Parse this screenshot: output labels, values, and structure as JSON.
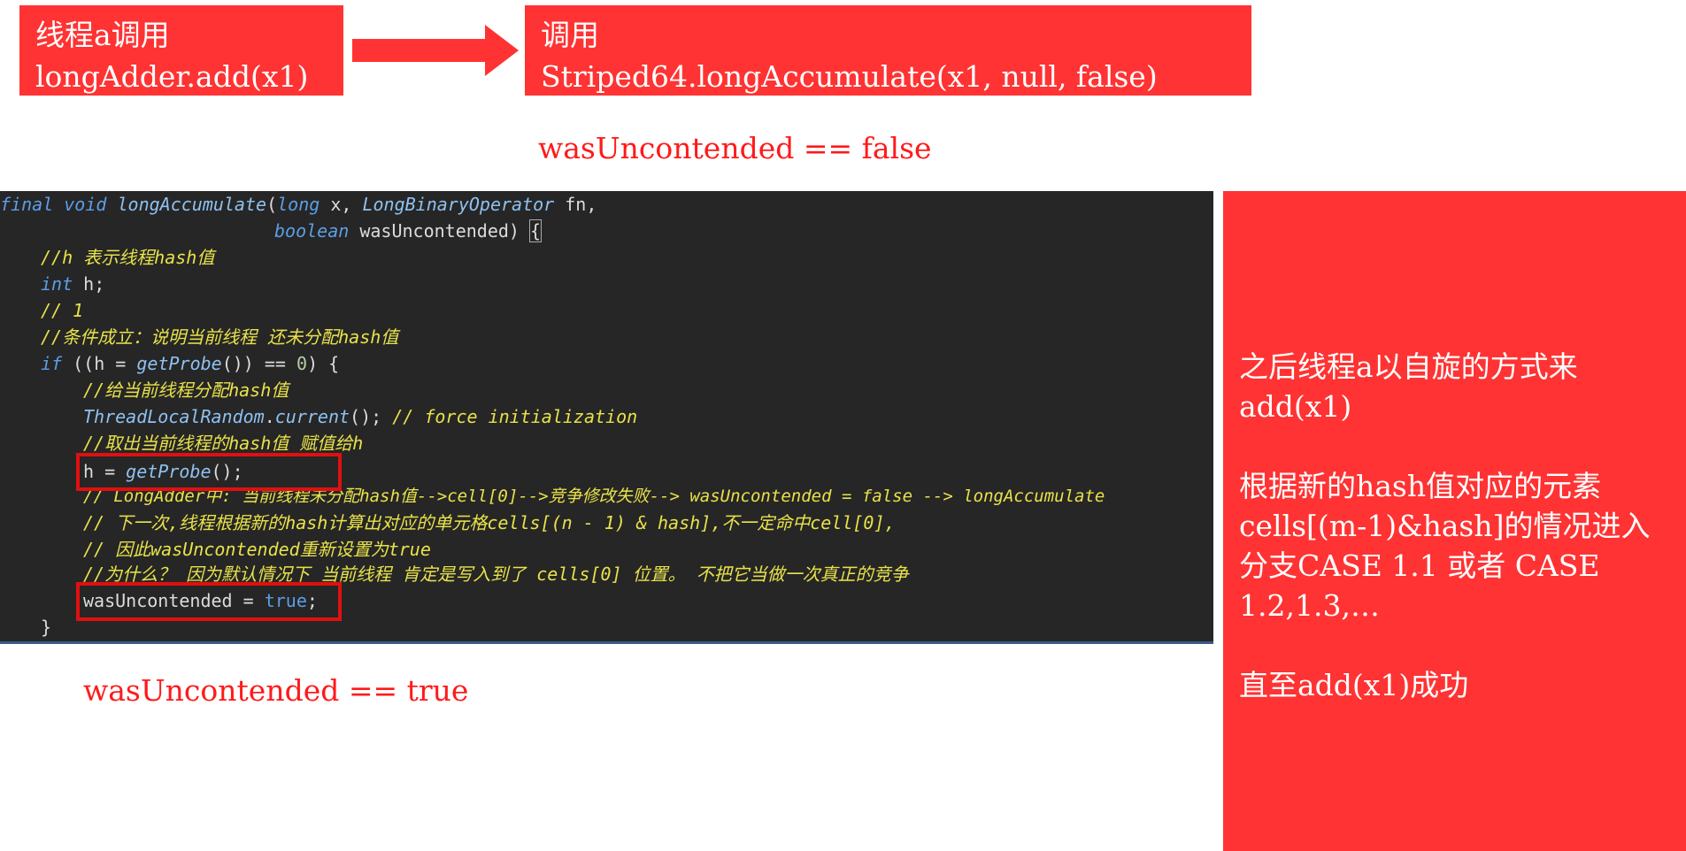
{
  "top_flow": {
    "box_a": {
      "line1": "线程a调用",
      "line2": "longAdder.add(x1)"
    },
    "box_b": {
      "line1": "调用",
      "line2": "Striped64.longAccumulate(x1, null, false)"
    }
  },
  "notes": {
    "was_false": "wasUncontended == false",
    "was_true": "wasUncontended == true"
  },
  "side_panel": {
    "para1": "之后线程a以自旋的方式来add(x1)",
    "para2": "根据新的hash值对应的元素cells[(m-1)&hash]的情况进入分支CASE 1.1 或者 CASE 1.2,1.3,…",
    "para3": "直至add(x1)成功"
  },
  "colors": {
    "accent_red": "#ff3333",
    "code_bg": "#262626",
    "comment": "#e8e24a",
    "keyword": "#5c9ee6"
  },
  "code": {
    "l1_kw1": "final",
    "l1_kw2": "void",
    "l1_fn": "longAccumulate",
    "l1_p1": "(",
    "l1_kw3": "long",
    "l1_p2": " x, ",
    "l1_type": "LongBinaryOperator",
    "l1_p3": " fn,",
    "l2_kw": "boolean",
    "l2_p1": " wasUncontended) ",
    "l2_brace": "{",
    "l3": "//h 表示线程hash值",
    "l4_kw": "int",
    "l4_p": " h;",
    "l5": "// 1",
    "l6": "//条件成立：说明当前线程 还未分配hash值",
    "l7_kw": "if",
    "l7_p1": " ((h = ",
    "l7_fn": "getProbe",
    "l7_p2": "()) == ",
    "l7_num": "0",
    "l7_p3": ") {",
    "l8": "//给当前线程分配hash值",
    "l9_fn": "ThreadLocalRandom",
    "l9_p1": ".",
    "l9_fn2": "current",
    "l9_p2": "(); ",
    "l9_cm": "// force initialization",
    "l10": "//取出当前线程的hash值 赋值给h",
    "l11_p1": "h = ",
    "l11_fn": "getProbe",
    "l11_p2": "();",
    "l12": "// LongAdder中: 当前线程未分配hash值-->cell[0]-->竞争修改失败--> wasUncontended = false --> longAccumulate",
    "l13": "// 下一次,线程根据新的hash计算出对应的单元格cells[(n - 1) & hash],不一定命中cell[0],",
    "l14": "// 因此wasUncontended重新设置为true",
    "l15": "//为什么？ 因为默认情况下 当前线程 肯定是写入到了 cells[0] 位置。 不把它当做一次真正的竞争",
    "l16_p1": "wasUncontended = ",
    "l16_kw": "true",
    "l16_p2": ";",
    "l17": "}"
  }
}
